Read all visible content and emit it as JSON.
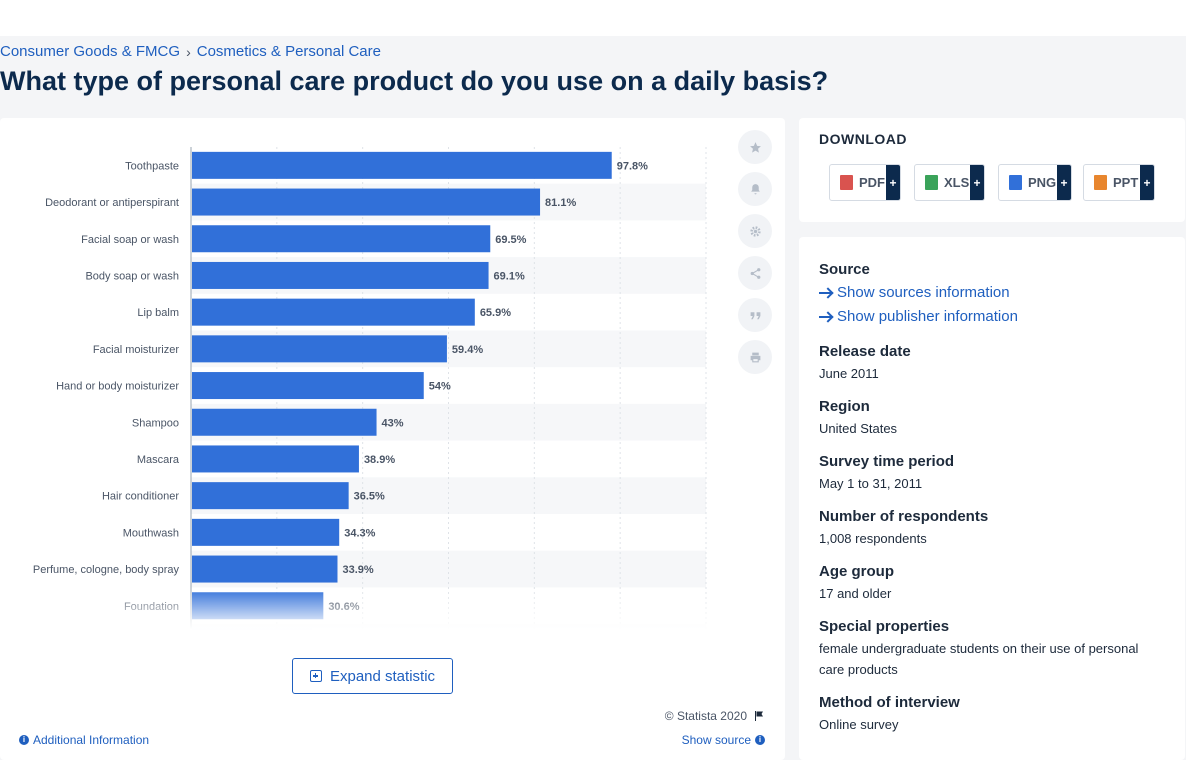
{
  "breadcrumb": {
    "item1": "Consumer Goods & FMCG",
    "item2": "Cosmetics & Personal Care",
    "separator": "›"
  },
  "page_title": "What type of personal care product do you use on a daily basis?",
  "chart_data": {
    "type": "bar",
    "orientation": "horizontal",
    "categories": [
      "Toothpaste",
      "Deodorant or antiperspirant",
      "Facial soap or wash",
      "Body soap or wash",
      "Lip balm",
      "Facial moisturizer",
      "Hand or body moisturizer",
      "Shampoo",
      "Mascara",
      "Hair conditioner",
      "Mouthwash",
      "Perfume, cologne, body spray",
      "Foundation"
    ],
    "values": [
      97.8,
      81.1,
      69.5,
      69.1,
      65.9,
      59.4,
      54,
      43,
      38.9,
      36.5,
      34.3,
      33.9,
      30.6
    ],
    "value_labels": [
      "97.8%",
      "81.1%",
      "69.5%",
      "69.1%",
      "65.9%",
      "59.4%",
      "54%",
      "43%",
      "38.9%",
      "36.5%",
      "34.3%",
      "33.9%",
      "30.6%"
    ],
    "xlim": [
      0,
      120
    ],
    "grid": true,
    "bar_color": "#3170d9",
    "stripe_color": "#f6f7f9",
    "truncated": true
  },
  "tools": {
    "star": "star-icon",
    "bell": "bell-icon",
    "settings": "gear-icon",
    "share": "share-icon",
    "cite": "quote-icon",
    "print": "print-icon"
  },
  "expand_label": "Expand statistic",
  "copyright": "© Statista 2020",
  "additional_info": "Additional Information",
  "show_source": "Show source",
  "download": {
    "title": "DOWNLOAD",
    "buttons": [
      {
        "label": "PDF",
        "color": "#d9534f"
      },
      {
        "label": "XLS",
        "color": "#3aa35a"
      },
      {
        "label": "PNG",
        "color": "#3170d9"
      },
      {
        "label": "PPT",
        "color": "#e8862e"
      }
    ],
    "plus": "+"
  },
  "details": {
    "source_title": "Source",
    "show_sources": "Show sources information",
    "show_publisher": "Show publisher information",
    "release_title": "Release date",
    "release_value": "June 2011",
    "region_title": "Region",
    "region_value": "United States",
    "survey_title": "Survey time period",
    "survey_value": "May 1 to 31, 2011",
    "respondents_title": "Number of respondents",
    "respondents_value": "1,008 respondents",
    "age_title": "Age group",
    "age_value": "17 and older",
    "special_title": "Special properties",
    "special_value": "female undergraduate students on their use of personal care products",
    "method_title": "Method of interview",
    "method_value": "Online survey"
  }
}
